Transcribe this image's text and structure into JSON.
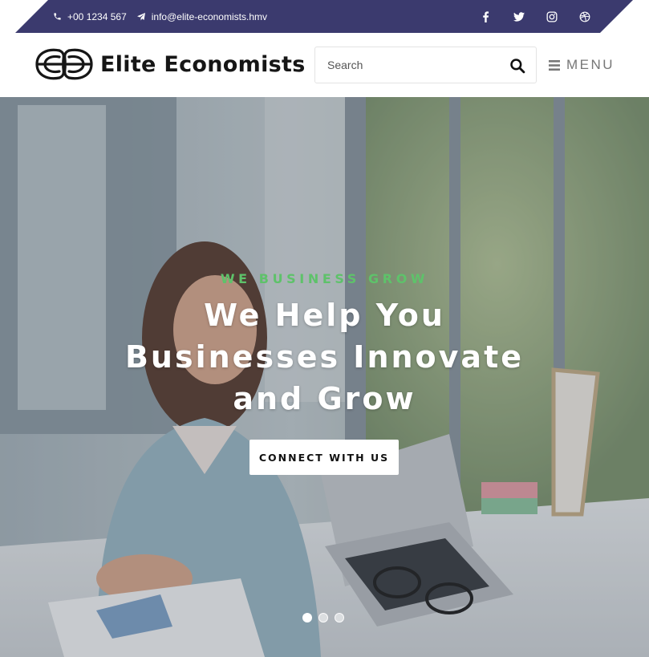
{
  "colors": {
    "topbar": "#3b3a6e",
    "accent_green": "#5ec26a",
    "logo_text": "#161616"
  },
  "topbar": {
    "phone_icon": "phone-icon",
    "phone": "+00 1234 567",
    "email_icon": "paper-plane-icon",
    "email": "info@elite-economists.hmv",
    "social": [
      "facebook-icon",
      "twitter-icon",
      "instagram-icon",
      "dribbble-icon"
    ]
  },
  "header": {
    "logo_text": "Elite Economists",
    "search_placeholder": "Search",
    "menu_label": "MENU"
  },
  "hero": {
    "kicker": "WE BUSINESS GROW",
    "title": "We Help You Businesses Innovate and Grow",
    "cta_label": "CONNECT WITH US",
    "slides_total": 3,
    "slide_active": 1
  }
}
